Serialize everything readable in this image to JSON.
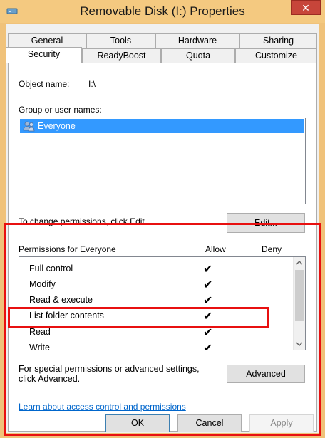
{
  "window": {
    "title": "Removable Disk (I:) Properties",
    "close_glyph": "✕"
  },
  "tabs_row1": [
    "General",
    "Tools",
    "Hardware",
    "Sharing"
  ],
  "tabs_row2": [
    "Security",
    "ReadyBoost",
    "Quota",
    "Customize"
  ],
  "active_tab": "Security",
  "object_name": {
    "label": "Object name:",
    "value": "I:\\"
  },
  "group": {
    "label": "Group or user names:",
    "items": [
      {
        "name": "Everyone",
        "icon": "users-icon",
        "selected": true
      }
    ]
  },
  "edit": {
    "hint": "To change permissions, click Edit.",
    "button": "Edit..."
  },
  "permissions": {
    "header": "Permissions for Everyone",
    "allow_col": "Allow",
    "deny_col": "Deny",
    "rows": [
      {
        "name": "Full control",
        "allow": true,
        "deny": false
      },
      {
        "name": "Modify",
        "allow": true,
        "deny": false
      },
      {
        "name": "Read & execute",
        "allow": true,
        "deny": false
      },
      {
        "name": "List folder contents",
        "allow": true,
        "deny": false
      },
      {
        "name": "Read",
        "allow": true,
        "deny": false
      },
      {
        "name": "Write",
        "allow": true,
        "deny": false
      }
    ],
    "check_glyph": "✔"
  },
  "advanced": {
    "hint_line1": "For special permissions or advanced settings,",
    "hint_line2": "click Advanced.",
    "button": "Advanced"
  },
  "link": "Learn about access control and permissions",
  "footer": {
    "ok": "OK",
    "cancel": "Cancel",
    "apply": "Apply"
  },
  "colors": {
    "highlight": "#e81010",
    "selection": "#3399ff",
    "titlebar": "#f4c980",
    "close": "#c7453a"
  }
}
